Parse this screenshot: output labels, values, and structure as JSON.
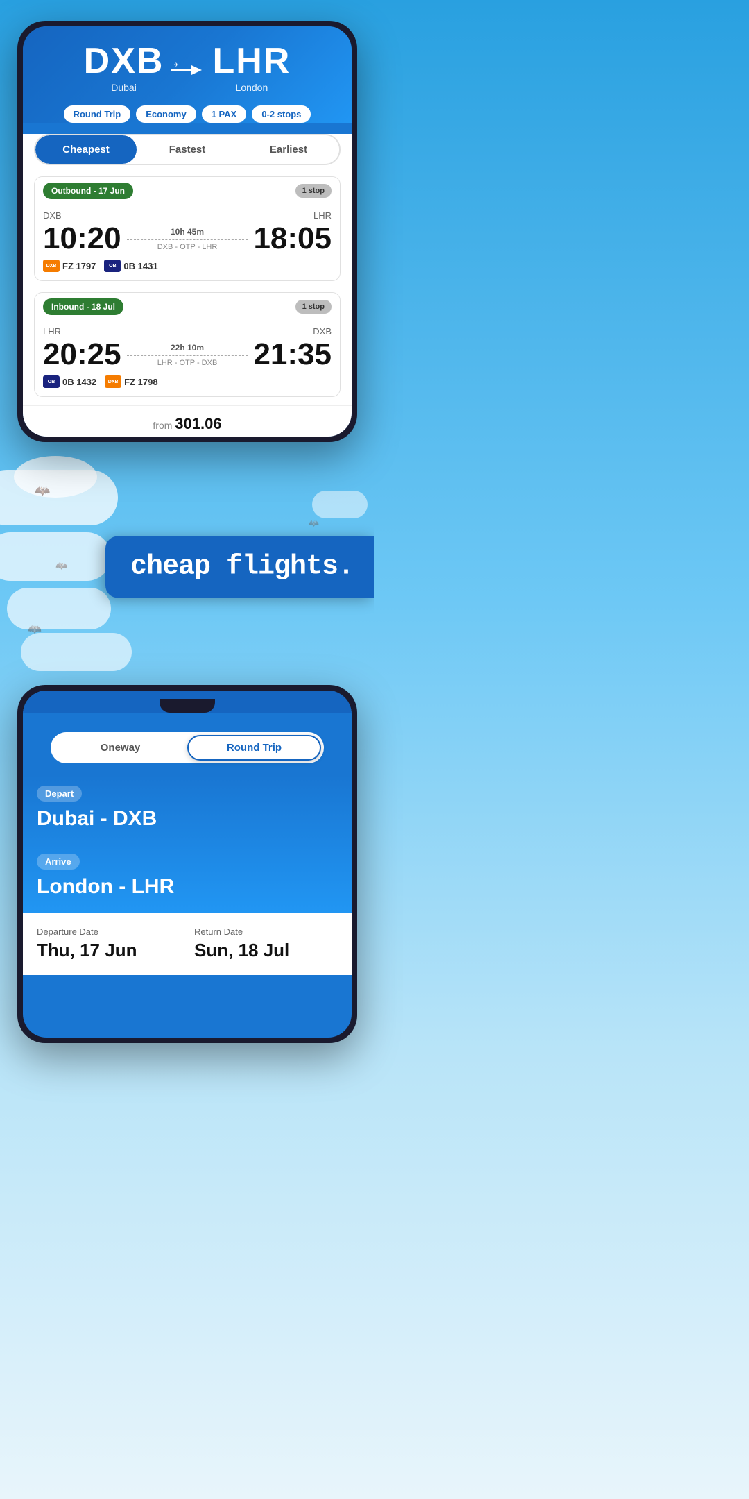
{
  "phone1": {
    "header": {
      "origin_code": "DXB",
      "origin_name": "Dubai",
      "dest_code": "LHR",
      "dest_name": "London",
      "badges": [
        "Round Trip",
        "Economy",
        "1 PAX",
        "0-2 stops"
      ]
    },
    "tabs": [
      {
        "label": "Cheapest",
        "active": true
      },
      {
        "label": "Fastest",
        "active": false
      },
      {
        "label": "Earliest",
        "active": false
      }
    ],
    "outbound": {
      "header_label": "Outbound - 17 Jun",
      "stops_label": "1 stop",
      "from": "DXB",
      "to": "LHR",
      "depart_time": "10:20",
      "arrive_time": "18:05",
      "duration": "10h 45m",
      "route": "DXB - OTP - LHR",
      "airline1_code": "FZ 1797",
      "airline1_logo": "dubai",
      "airline2_code": "0B 1431",
      "airline2_logo": "blue"
    },
    "inbound": {
      "header_label": "Inbound - 18 Jul",
      "stops_label": "1 stop",
      "from": "LHR",
      "to": "DXB",
      "depart_time": "20:25",
      "arrive_time": "21:35",
      "duration": "22h 10m",
      "route": "LHR - OTP - DXB",
      "airline1_code": "0B 1432",
      "airline1_logo": "blue",
      "airline2_code": "FZ 1798",
      "airline2_logo": "dubai"
    }
  },
  "banner": {
    "text": "cheap flights."
  },
  "phone2": {
    "toggle": {
      "option1": "Oneway",
      "option2": "Round Trip",
      "selected": "Round Trip"
    },
    "depart_label": "Depart",
    "depart_value": "Dubai - DXB",
    "arrive_label": "Arrive",
    "arrive_value": "London - LHR",
    "departure_date_label": "Departure Date",
    "departure_date_value": "Thu, 17 Jun",
    "return_date_label": "Return Date",
    "return_date_value": "Sun, 18 Jul"
  }
}
